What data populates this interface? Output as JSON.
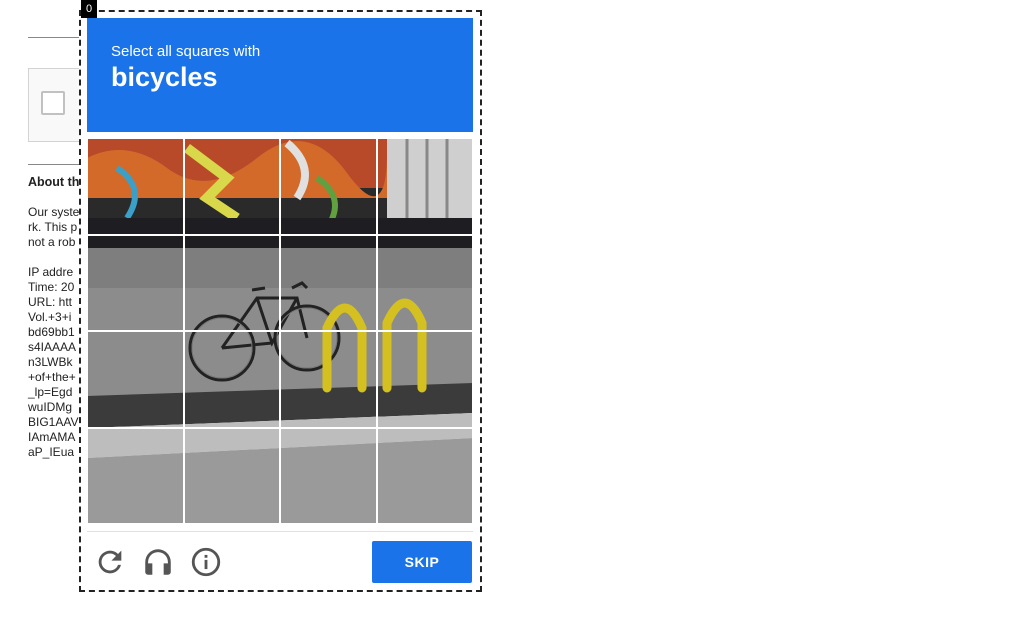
{
  "background_page": {
    "heading": "About th",
    "lines": [
      "Our syste",
      "rk. This p",
      "not a rob",
      "",
      "IP addre",
      "Time: 20",
      "URL: htt",
      "Vol.+3+i",
      "bd69bb1",
      "s4IAAAA",
      "n3LWBk",
      "+of+the+",
      "_lp=Egd",
      "wuIDMg",
      "BIG1AAV",
      "IAmAMA",
      "aP_IEua"
    ]
  },
  "challenge": {
    "counter": "0",
    "instruction": "Select all squares with",
    "target": "bicycles",
    "grid": {
      "rows": 4,
      "cols": 4
    },
    "skip_label": "SKIP",
    "icons": [
      "reload-icon",
      "audio-icon",
      "info-icon"
    ]
  },
  "colors": {
    "accent": "#1a73e8"
  }
}
